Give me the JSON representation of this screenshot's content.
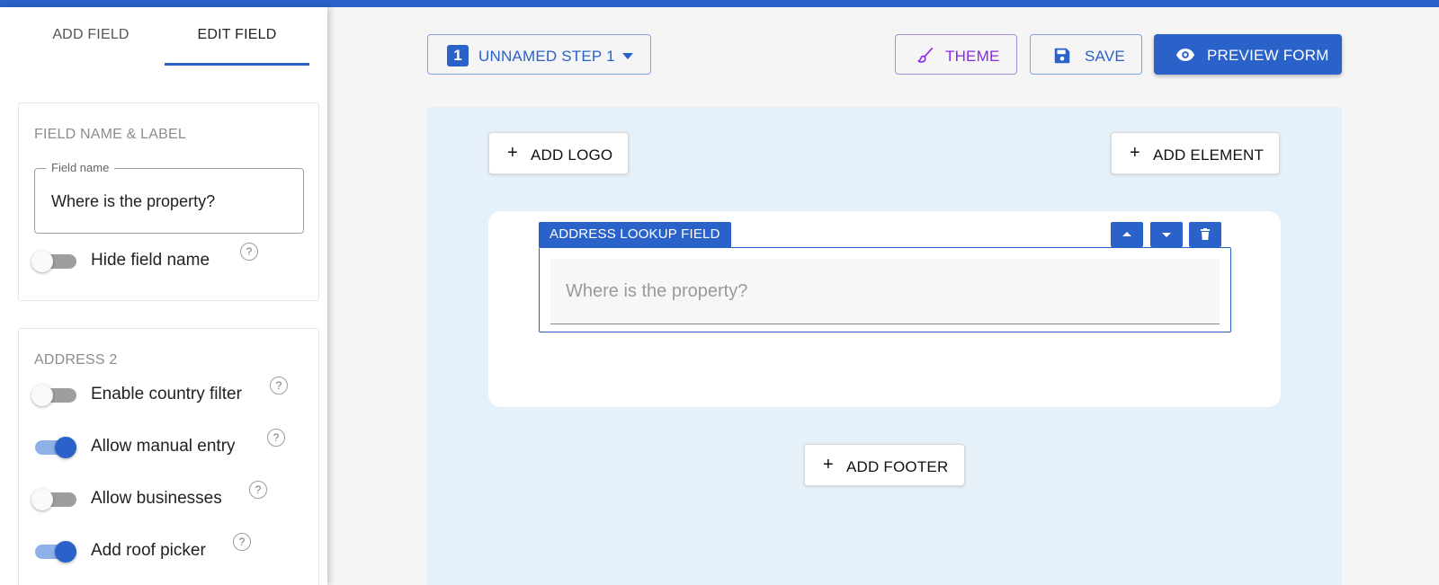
{
  "sidebar": {
    "tabs": [
      {
        "label": "ADD FIELD"
      },
      {
        "label": "EDIT FIELD",
        "active": true
      }
    ],
    "field_section": {
      "title": "FIELD NAME & LABEL",
      "field_name_legend": "Field name",
      "field_name_value": "Where is the property?",
      "hide_field_name": {
        "label": "Hide field name",
        "on": false,
        "help": "?"
      }
    },
    "address_section": {
      "title": "ADDRESS 2",
      "toggles": [
        {
          "label": "Enable country filter",
          "on": false,
          "help": "?"
        },
        {
          "label": "Allow manual entry",
          "on": true,
          "help": "?"
        },
        {
          "label": "Allow businesses",
          "on": false,
          "help": "?"
        },
        {
          "label": "Add roof picker",
          "on": true,
          "help": "?"
        }
      ]
    }
  },
  "toolbar": {
    "step": {
      "number": "1",
      "label": "UNNAMED STEP 1"
    },
    "theme_label": "THEME",
    "save_label": "SAVE",
    "preview_label": "PREVIEW FORM"
  },
  "canvas": {
    "add_logo_label": "ADD LOGO",
    "add_element_label": "ADD ELEMENT",
    "add_footer_label": "ADD FOOTER",
    "plus_symbol": "+",
    "field": {
      "tag": "ADDRESS LOOKUP FIELD",
      "placeholder": "Where is the property?"
    }
  },
  "colors": {
    "accent": "#2a62c9",
    "theme": "#8a2be2",
    "canvas_bg": "#e6f0f9"
  }
}
